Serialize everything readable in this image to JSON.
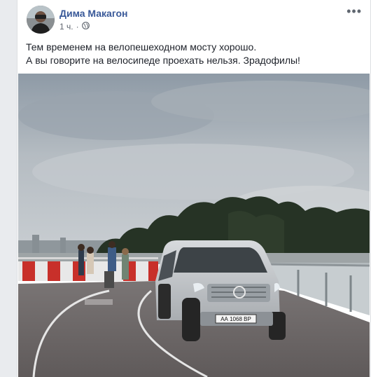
{
  "post": {
    "author": "Дима Макагон",
    "time": "1 ч.",
    "privacy_icon": "globe-icon",
    "more_icon": "more-dots-icon",
    "text_line1": "Тем временем на велопешеходном мосту хорошо.",
    "text_line2": "А вы говорите на велосипеде проехать нельзя. Зрадофилы!"
  },
  "photo": {
    "license_plate": "АА 1068 ВР"
  },
  "colors": {
    "author_link": "#385898",
    "meta_text": "#616770",
    "body_text": "#1d2129"
  }
}
